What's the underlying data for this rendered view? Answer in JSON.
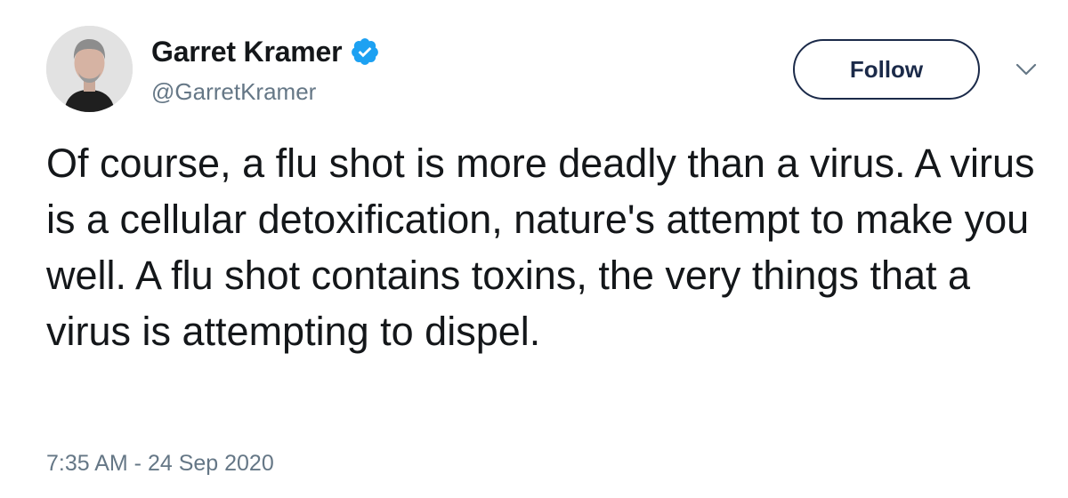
{
  "author": {
    "display_name": "Garret Kramer",
    "handle": "@GarretKramer",
    "verified": true,
    "avatar_icon": "person-avatar",
    "verified_icon": "verified-badge-icon",
    "verified_color": "#1da1f2"
  },
  "actions": {
    "follow_label": "Follow",
    "menu_icon": "chevron-down-icon"
  },
  "tweet": {
    "text": "Of course, a flu shot is more deadly than a virus. A virus is a cellular detoxification, nature's attempt to make you well. A flu shot contains toxins, the very things that a virus is attempting to dispel.",
    "timestamp": "7:35 AM - 24 Sep 2020"
  },
  "colors": {
    "text_primary": "#14171a",
    "text_secondary": "#657786",
    "follow_border": "#1b2a49"
  }
}
